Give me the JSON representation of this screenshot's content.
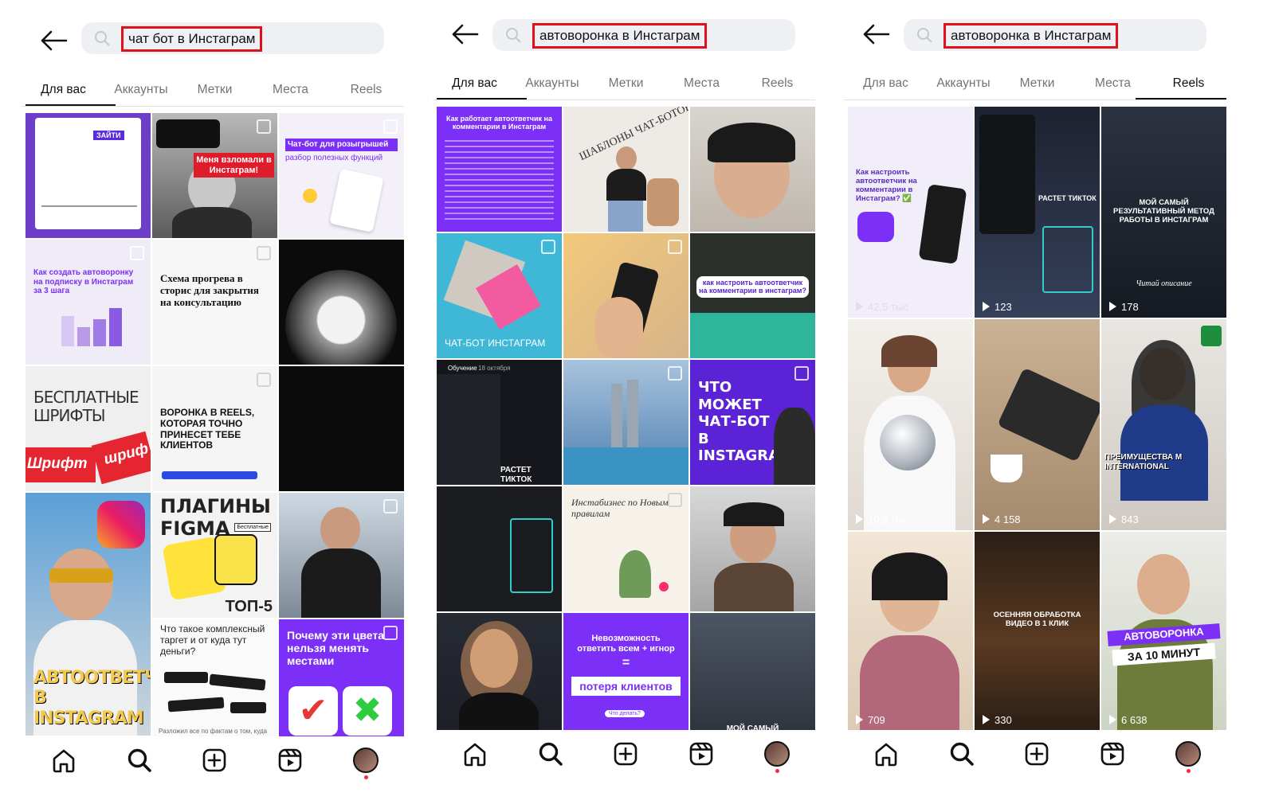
{
  "panels": [
    {
      "search_query": "чат бот в Инстаграм",
      "tabs": [
        "Для вас",
        "Аккаунты",
        "Метки",
        "Места",
        "Reels"
      ],
      "active_tab": "Для вас",
      "tiles": [
        "ЗАЙТИ",
        "Меня взломали в Инстаграм!",
        "Чат-бот для розыгрышей",
        "разбор полезных функций",
        "Как создать автоворонку на подписку в Инстаграм за 3 шага",
        "Схема прогрева в сторис для закрытия на консультацию",
        "БЕСПЛАТНЫЕ ШРИФТЫ",
        "Шрифт",
        "шриф",
        "ВОРОНКА В REELS, КОТОРАЯ ТОЧНО ПРИНЕСЕТ ТЕБЕ КЛИЕНТОВ",
        "АВТООТВЕТЧИК В INSTAGRAM",
        "ПЛАГИНЫ FIGMA",
        "Бесплатные",
        "ТОП-5",
        "Что такое комплексный таргет и от куда тут деньги?",
        "Разложил все по фактам о том, куда",
        "Почему эти цвета нельзя менять местами"
      ]
    },
    {
      "search_query": "автоворонка в Инстаграм",
      "tabs": [
        "Для вас",
        "Аккаунты",
        "Метки",
        "Места",
        "Reels"
      ],
      "active_tab": "Для вас",
      "tiles": [
        "Как работает автоответчик на комментарии в Инстаграм",
        "ШАБЛОНЫ ЧАТ-БОТОВ",
        "ЧАТ-БОТ ИНСТАГРАМ",
        "как настроить автоответчик на комментарии в инстаграм?",
        "Обучение",
        "18 октября",
        "РАСТЕТ ТИКТОК",
        "ЧТО МОЖЕТ ЧАТ-БОТ В INSTAGRAM",
        "Инстабизнес по Новым правилам",
        "Невозможность ответить всем + игнор",
        "=",
        "потеря клиентов",
        "Что делать?",
        "МОЙ САМЫЙ"
      ]
    },
    {
      "search_query": "автоворонка в Инстаграм",
      "tabs": [
        "Для вас",
        "Аккаунты",
        "Метки",
        "Места",
        "Reels"
      ],
      "active_tab": "Reels",
      "tiles": [
        "Как настроить автоответчик на комментарии в Инстаграм? ✅",
        "РАСТЕТ ТИКТОК",
        "МОЙ САМЫЙ РЕЗУЛЬТАТИВНЫЙ МЕТОД РАБОТЫ В ИНСТАГРАМ",
        "Читай описание",
        "ПРЕИМУЩЕСТВА M INTERNATIONAL",
        "ОСЕННЯЯ ОБРАБОТКА ВИДЕО В 1 КЛИК",
        "АВТОВОРОНКА",
        "ЗА 10 МИНУТ"
      ],
      "play_counts": [
        "42,5 тыс",
        "123",
        "178",
        "10,9 тыс",
        "4 158",
        "843",
        "709",
        "330",
        "6 638"
      ]
    }
  ],
  "nav_icons": [
    "home-icon",
    "search-icon",
    "create-icon",
    "reels-icon",
    "profile-avatar"
  ],
  "colors": {
    "highlight": "#e0101b",
    "accent_purple": "#7b2ff7",
    "notification_dot": "#ff2442"
  }
}
